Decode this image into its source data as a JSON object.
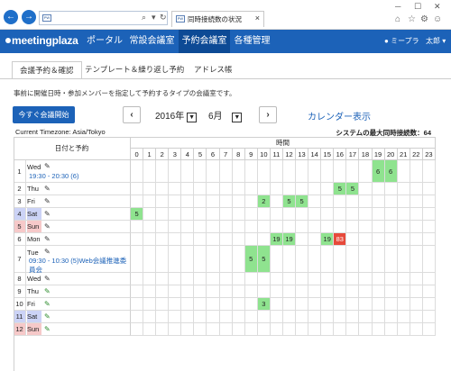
{
  "browser": {
    "address_favicon": "PW",
    "address_icons": [
      "search-icon",
      "refresh-icon",
      "dropdown-icon"
    ],
    "tab_title": "同時接続数の状況",
    "tab_favicon": "PW",
    "window_controls": [
      "minimize",
      "maximize",
      "close"
    ],
    "toolbar_icons": [
      "home-icon",
      "star-icon",
      "gear-icon",
      "smiley-icon"
    ]
  },
  "app": {
    "logo": "meetingplaza",
    "menu": [
      "ポータル",
      "常設会議室",
      "予約会議室",
      "各種管理"
    ],
    "active_menu": "予約会議室",
    "user": "ミープラ",
    "user_sub": "太郎"
  },
  "subtabs": [
    "会議予約＆確認",
    "テンプレート＆繰り返し予約",
    "アドレス帳"
  ],
  "description": "事前に開催日時・参加メンバーを指定して予約するタイプの会議室です。",
  "controls": {
    "start_button": "今すぐ会議開始",
    "prev": "‹",
    "next": "›",
    "year": "2016年",
    "month": "6月",
    "calendar_link": "カレンダー表示"
  },
  "timezone": "Current Timezone: Asia/Tokyo",
  "max_connections": "システムの最大同時接続数：64",
  "grid": {
    "date_header": "日付と予約",
    "time_header": "時間",
    "hours": [
      "0",
      "1",
      "2",
      "3",
      "4",
      "5",
      "6",
      "7",
      "8",
      "9",
      "10",
      "11",
      "12",
      "13",
      "14",
      "15",
      "16",
      "17",
      "18",
      "19",
      "20",
      "21",
      "22",
      "23"
    ],
    "days": [
      {
        "num": "1",
        "dow": "Wed",
        "type": "weekday",
        "event": "19:30 - 20:30 (6)",
        "cells": {
          "19": "6",
          "20": "6"
        }
      },
      {
        "num": "2",
        "dow": "Thu",
        "type": "weekday",
        "event": "",
        "cells": {
          "16": "5",
          "17": "5"
        }
      },
      {
        "num": "3",
        "dow": "Fri",
        "type": "weekday",
        "event": "",
        "cells": {
          "10": "2",
          "12": "5",
          "13": "5"
        }
      },
      {
        "num": "4",
        "dow": "Sat",
        "type": "sat",
        "event": "",
        "cells": {
          "0": "5"
        }
      },
      {
        "num": "5",
        "dow": "Sun",
        "type": "sun",
        "event": "",
        "cells": {}
      },
      {
        "num": "6",
        "dow": "Mon",
        "type": "weekday",
        "event": "",
        "cells": {
          "11": "19",
          "12": "19",
          "15": "19",
          "16": "83"
        }
      },
      {
        "num": "7",
        "dow": "Tue",
        "type": "weekday",
        "event": "09:30 - 10:30 (5)Web会議推進委員会",
        "cells": {
          "9": "5",
          "10": "5"
        }
      },
      {
        "num": "8",
        "dow": "Wed",
        "type": "weekday",
        "event": "",
        "cells": {}
      },
      {
        "num": "9",
        "dow": "Thu",
        "type": "weekday",
        "event": "",
        "cells": {}
      },
      {
        "num": "10",
        "dow": "Fri",
        "type": "weekday",
        "event": "",
        "cells": {
          "10": "3"
        }
      },
      {
        "num": "11",
        "dow": "Sat",
        "type": "sat",
        "event": "",
        "cells": {}
      },
      {
        "num": "12",
        "dow": "Sun",
        "type": "sun",
        "event": "",
        "cells": {}
      }
    ],
    "hot_threshold_cell": "83",
    "colors": {
      "filled": "#8fe38f",
      "hot": "#e74a3b",
      "sat": "#ccd3f6",
      "sun": "#f6c9c9",
      "accent": "#1c62b8"
    }
  }
}
